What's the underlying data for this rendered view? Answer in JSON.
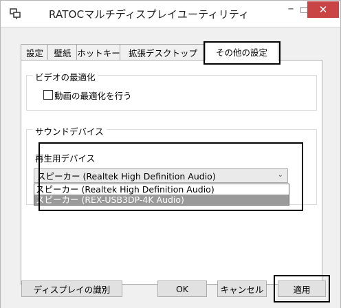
{
  "window": {
    "title": "RATOCマルチディスプレイユーティリティ"
  },
  "tabs": [
    {
      "label": "設定"
    },
    {
      "label": "壁紙"
    },
    {
      "label": "ホットキー"
    },
    {
      "label": "拡張デスクトップ"
    },
    {
      "label": "その他の設定"
    }
  ],
  "video_group": {
    "title": "ビデオの最適化",
    "checkbox_label": "動画の最適化を行う",
    "checked": false
  },
  "sound_group": {
    "title": "サウンドデバイス",
    "playback_label": "再生用デバイス",
    "selected": "スピーカー (Realtek High Definition Audio)",
    "options": [
      "スピーカー (Realtek High Definition Audio)",
      "スピーカー (REX-USB3DP-4K Audio)"
    ]
  },
  "buttons": {
    "identify": "ディスプレイの識別",
    "ok": "OK",
    "cancel": "キャンセル",
    "apply": "適用"
  }
}
